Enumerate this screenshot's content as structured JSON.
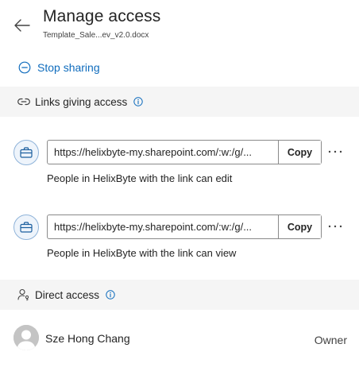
{
  "header": {
    "title": "Manage access",
    "filename": "Template_Sale...ev_v2.0.docx"
  },
  "actions": {
    "stop_sharing_label": "Stop sharing"
  },
  "links_section": {
    "title": "Links giving access",
    "links": [
      {
        "url": "https://helixbyte-my.sharepoint.com/:w:/g/...",
        "copy_label": "Copy",
        "description": "People in HelixByte with the link can edit"
      },
      {
        "url": "https://helixbyte-my.sharepoint.com/:w:/g/...",
        "copy_label": "Copy",
        "description": "People in HelixByte with the link can view"
      }
    ]
  },
  "direct_section": {
    "title": "Direct access",
    "users": [
      {
        "name": "Sze Hong Chang",
        "role": "Owner"
      }
    ]
  },
  "colors": {
    "accent": "#0f6cbd",
    "section_bg": "#f5f5f5",
    "text": "#242424"
  },
  "icons": {
    "back": "arrow-left-icon",
    "stop": "minus-circle-icon",
    "link": "link-icon",
    "info": "info-icon",
    "link_type": "briefcase-icon",
    "more": "more-horizontal-icon",
    "person": "person-key-icon",
    "avatar": "avatar-placeholder"
  }
}
